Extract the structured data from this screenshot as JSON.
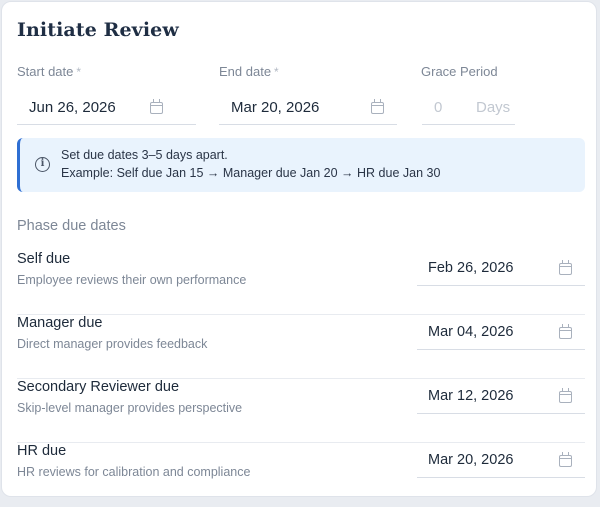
{
  "form": {
    "title": "Initiate Review",
    "start_date": {
      "label": "Start date",
      "required_mark": "*",
      "value": "Jun 26, 2026",
      "icon": "calendar-icon"
    },
    "end_date": {
      "label": "End date",
      "required_mark": "*",
      "value": "Mar 20, 2026",
      "icon": "calendar-icon"
    },
    "grace_period": {
      "label": "Grace Period",
      "value": "0",
      "unit": "Days"
    }
  },
  "info_banner": {
    "icon": "info-icon",
    "line1": "Set due dates 3–5 days apart.",
    "line2": "Example:  Self due Jan 15 → Manager due Jan 20 → HR due Jan 30",
    "accent_color": "#2f6fd3",
    "background": "#e9f3fd"
  },
  "phases": {
    "section_title": "Phase due dates",
    "items": [
      {
        "name": "Self due",
        "description": "Employee reviews their own performance",
        "date": "Feb 26, 2026"
      },
      {
        "name": "Manager due",
        "description": "Direct manager provides feedback",
        "date": "Mar 04, 2026"
      },
      {
        "name": "Secondary Reviewer due",
        "description": "Skip-level manager provides perspective",
        "date": "Mar 12, 2026"
      },
      {
        "name": "HR due",
        "description": "HR reviews for calibration and compliance",
        "date": "Mar 20, 2026"
      }
    ]
  }
}
